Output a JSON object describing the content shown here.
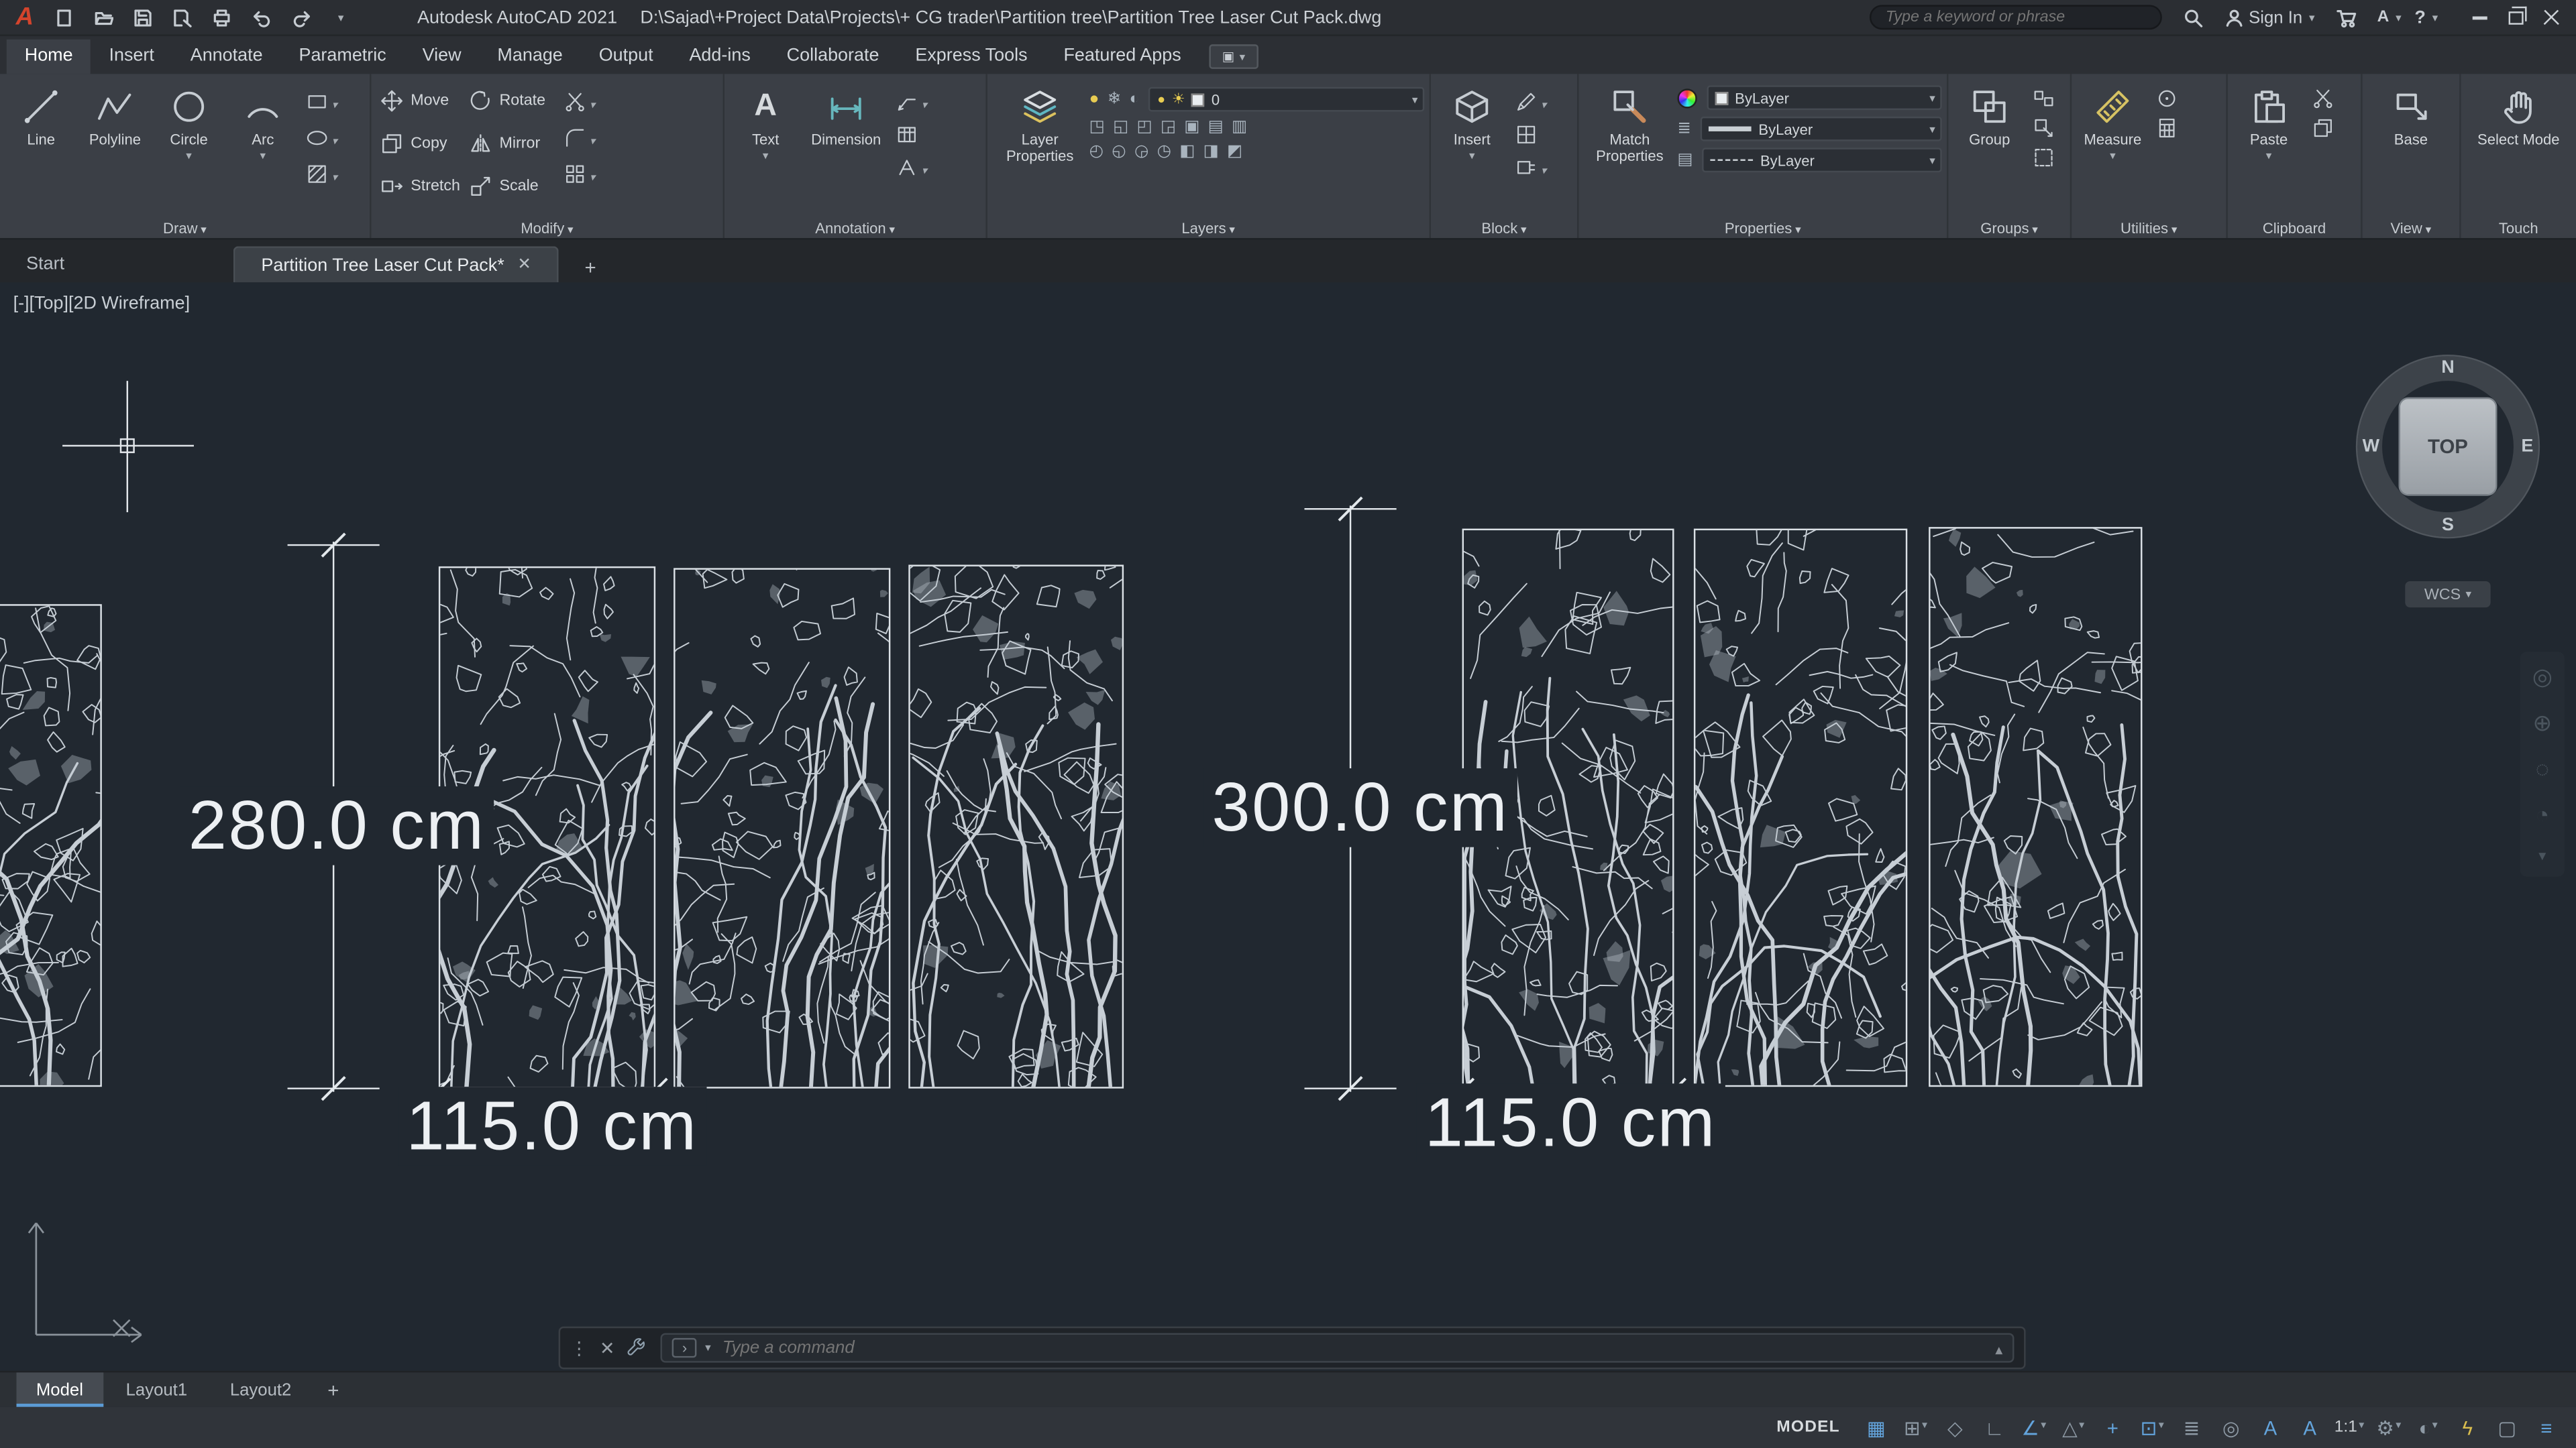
{
  "titlebar": {
    "app_title": "Autodesk AutoCAD 2021",
    "doc_path": "D:\\Sajad\\+Project Data\\Projects\\+ CG trader\\Partition tree\\Partition Tree Laser Cut Pack.dwg",
    "search_placeholder": "Type a keyword or phrase",
    "signin": "Sign In",
    "help": "?"
  },
  "ribbon_tabs": [
    "Home",
    "Insert",
    "Annotate",
    "Parametric",
    "View",
    "Manage",
    "Output",
    "Add-ins",
    "Collaborate",
    "Express Tools",
    "Featured Apps"
  ],
  "ribbon": {
    "draw": {
      "label": "Draw",
      "line": "Line",
      "polyline": "Polyline",
      "circle": "Circle",
      "arc": "Arc"
    },
    "modify": {
      "label": "Modify",
      "move": "Move",
      "rotate": "Rotate",
      "copy": "Copy",
      "mirror": "Mirror",
      "stretch": "Stretch",
      "scale": "Scale"
    },
    "annotation": {
      "label": "Annotation",
      "text": "Text",
      "dimension": "Dimension"
    },
    "layers": {
      "label": "Layers",
      "big": "Layer Properties",
      "current_layer": "0"
    },
    "block": {
      "label": "Block",
      "insert": "Insert"
    },
    "properties": {
      "label": "Properties",
      "big": "Match Properties",
      "color": "ByLayer",
      "lineweight": "ByLayer",
      "linetype": "ByLayer"
    },
    "groups": {
      "label": "Groups",
      "group": "Group"
    },
    "utilities": {
      "label": "Utilities",
      "measure": "Measure"
    },
    "clipboard": {
      "label": "Clipboard",
      "paste": "Paste"
    },
    "view": {
      "label": "View",
      "base": "Base"
    },
    "touch": {
      "label": "Touch",
      "select": "Select Mode"
    }
  },
  "doc_tabs": {
    "start": "Start",
    "active": "Partition Tree Laser Cut Pack*"
  },
  "viewport": {
    "minimize": "[-]",
    "view": "[Top]",
    "visual_style": "[2D Wireframe]"
  },
  "viewcube": {
    "n": "N",
    "e": "E",
    "s": "S",
    "w": "W",
    "face": "TOP",
    "wcs": "WCS"
  },
  "dimensions": {
    "left_height": "280.0 cm",
    "left_width": "115.0 cm",
    "right_height": "300.0 cm",
    "right_width": "115.0 cm"
  },
  "command_bar": {
    "placeholder": "Type a command"
  },
  "layout_tabs": {
    "model": "Model",
    "layout1": "Layout1",
    "layout2": "Layout2"
  },
  "statusbar": {
    "model": "MODEL",
    "icons": [
      {
        "name": "grid",
        "glyph": "▦"
      },
      {
        "name": "snap-mode",
        "glyph": "⊞"
      },
      {
        "name": "infer-constraints",
        "glyph": "◇"
      },
      {
        "name": "ortho-mode",
        "glyph": "∟"
      },
      {
        "name": "polar-tracking",
        "glyph": "∠"
      },
      {
        "name": "isometric-drafting",
        "glyph": "△"
      },
      {
        "name": "object-snap-tracking",
        "glyph": "+"
      },
      {
        "name": "object-snap",
        "glyph": "⊡"
      },
      {
        "name": "lineweight",
        "glyph": "≣"
      },
      {
        "name": "selection-cycling",
        "glyph": "◎"
      },
      {
        "name": "annotation-visibility",
        "glyph": "A"
      },
      {
        "name": "autoscale",
        "glyph": "A"
      },
      {
        "name": "annotation-scale",
        "glyph": "1:1"
      },
      {
        "name": "workspace-switching",
        "glyph": "⚙"
      },
      {
        "name": "isolate-objects",
        "glyph": "◐"
      },
      {
        "name": "graphics-performance",
        "glyph": "ϟ"
      },
      {
        "name": "clean-screen",
        "glyph": "▢"
      },
      {
        "name": "customization",
        "glyph": "≡"
      }
    ]
  }
}
